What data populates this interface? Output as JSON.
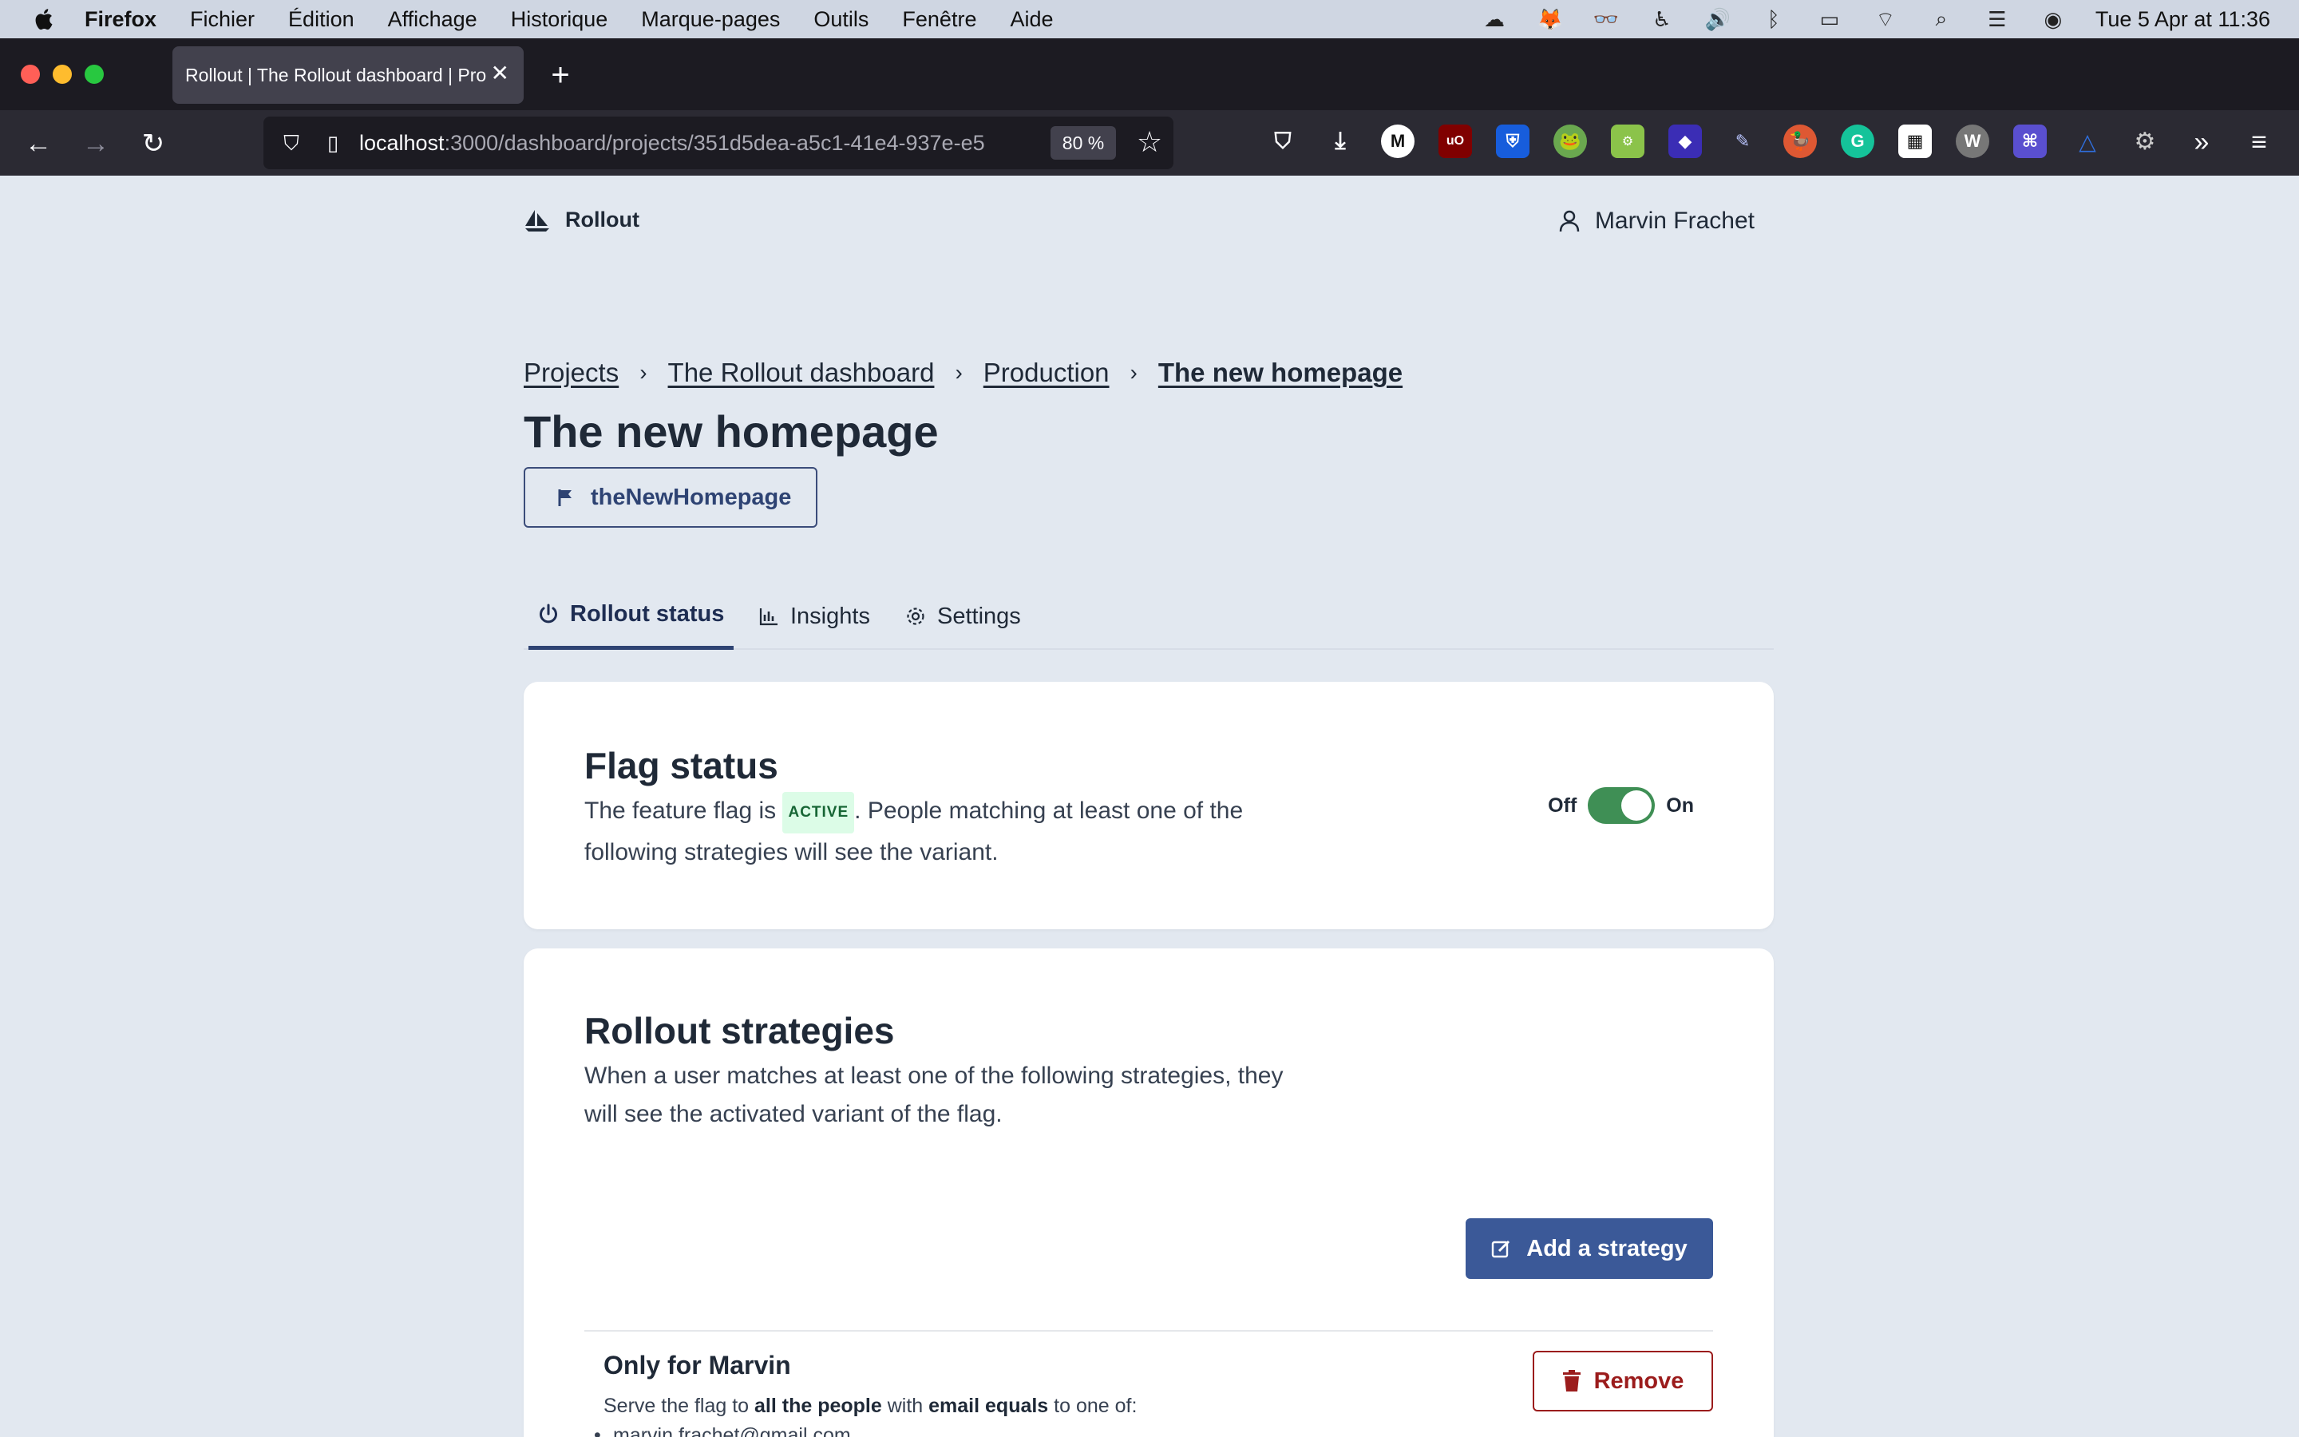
{
  "menubar": {
    "app": "Firefox",
    "items": [
      "Fichier",
      "Édition",
      "Affichage",
      "Historique",
      "Marque-pages",
      "Outils",
      "Fenêtre",
      "Aide"
    ],
    "clock": "Tue 5 Apr at  11:36"
  },
  "browser": {
    "tab_title": "Rollout | The Rollout dashboard | Pro",
    "url_host": "localhost",
    "url_path": ":3000/dashboard/projects/351d5dea-a5c1-41e4-937e-e5",
    "zoom": "80 %"
  },
  "app": {
    "brand": "Rollout",
    "user_name": "Marvin Frachet"
  },
  "breadcrumb": {
    "items": [
      "Projects",
      "The Rollout dashboard",
      "Production"
    ],
    "current": "The new homepage",
    "separator": "›"
  },
  "page": {
    "title": "The new homepage",
    "flag_key": "theNewHomepage"
  },
  "tabs": [
    {
      "label": "Rollout status",
      "active": true
    },
    {
      "label": "Insights",
      "active": false
    },
    {
      "label": "Settings",
      "active": false
    }
  ],
  "flag_status": {
    "heading": "Flag status",
    "desc_before": "The feature flag is ",
    "badge": "ACTIVE",
    "desc_after": ". People matching at least one of the following strategies will see the variant.",
    "off_label": "Off",
    "on_label": "On",
    "enabled": true
  },
  "strategies": {
    "heading": "Rollout strategies",
    "description": "When a user matches at least one of the following strategies, they will see the activated variant of the flag.",
    "add_label": "Add a strategy",
    "remove_label": "Remove",
    "items": [
      {
        "name": "Only for Marvin",
        "serve_prefix": "Serve the flag to ",
        "audience": "all the people",
        "with_text": " with ",
        "rule": "email equals",
        "suffix": " to one of:",
        "values": [
          "marvin.frachet@gmail.com"
        ]
      }
    ]
  },
  "colors": {
    "accent": "#3b5998",
    "toggle_on": "#3f8f55",
    "danger": "#9b1c1c",
    "page_bg": "#e2e8f0"
  }
}
